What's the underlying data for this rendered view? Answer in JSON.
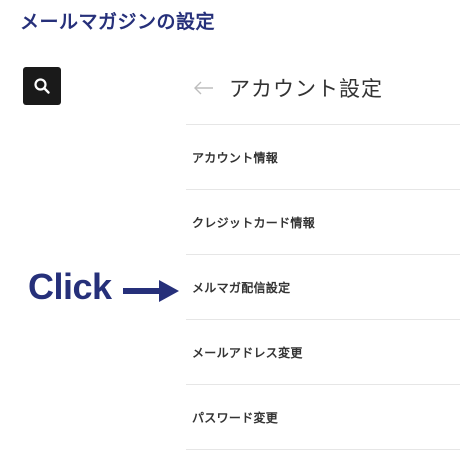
{
  "page_title": "メールマガジンの設定",
  "search": {
    "icon": "search-icon"
  },
  "account": {
    "back_icon": "arrow-left-icon",
    "title": "アカウント設定"
  },
  "menu": {
    "items": [
      {
        "label": "アカウント情報"
      },
      {
        "label": "クレジットカード情報"
      },
      {
        "label": "メルマガ配信設定"
      },
      {
        "label": "メールアドレス変更"
      },
      {
        "label": "パスワード変更"
      }
    ]
  },
  "annotation": {
    "label": "Click",
    "arrow_icon": "arrow-right-icon",
    "color": "#26307a"
  },
  "colors": {
    "title": "#26307a",
    "search_bg": "#1a1a1a",
    "divider": "#e6e6e6"
  }
}
